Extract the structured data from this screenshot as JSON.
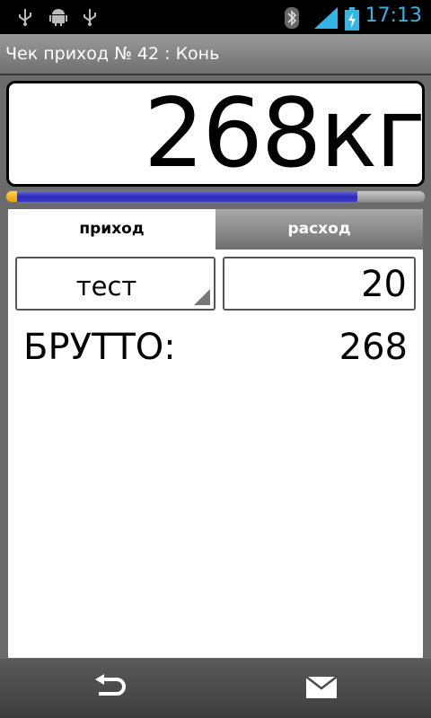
{
  "status_bar": {
    "time": "17:13",
    "icons_left": [
      "usb-icon",
      "android-debug-icon",
      "usb-icon"
    ],
    "icons_right": [
      "bluetooth-icon",
      "signal-icon",
      "battery-charging-icon"
    ],
    "time_color": "#33b5e5"
  },
  "header": {
    "title": "Чек приход № 42 : Конь"
  },
  "scale": {
    "weight_display": "268кг",
    "progress_fraction": 0.84
  },
  "tabs": [
    {
      "label": "приход",
      "selected": true
    },
    {
      "label": "расход",
      "selected": false
    }
  ],
  "form": {
    "product_spinner_value": "тест",
    "quantity_value": "20",
    "gross_label": "БРУТТО:",
    "gross_value": "268"
  },
  "bottom_nav": {
    "icons": [
      "back-icon",
      "mail-icon"
    ]
  },
  "colors": {
    "progress_fill": "#2a2ab8",
    "progress_start": "#f0a000"
  }
}
